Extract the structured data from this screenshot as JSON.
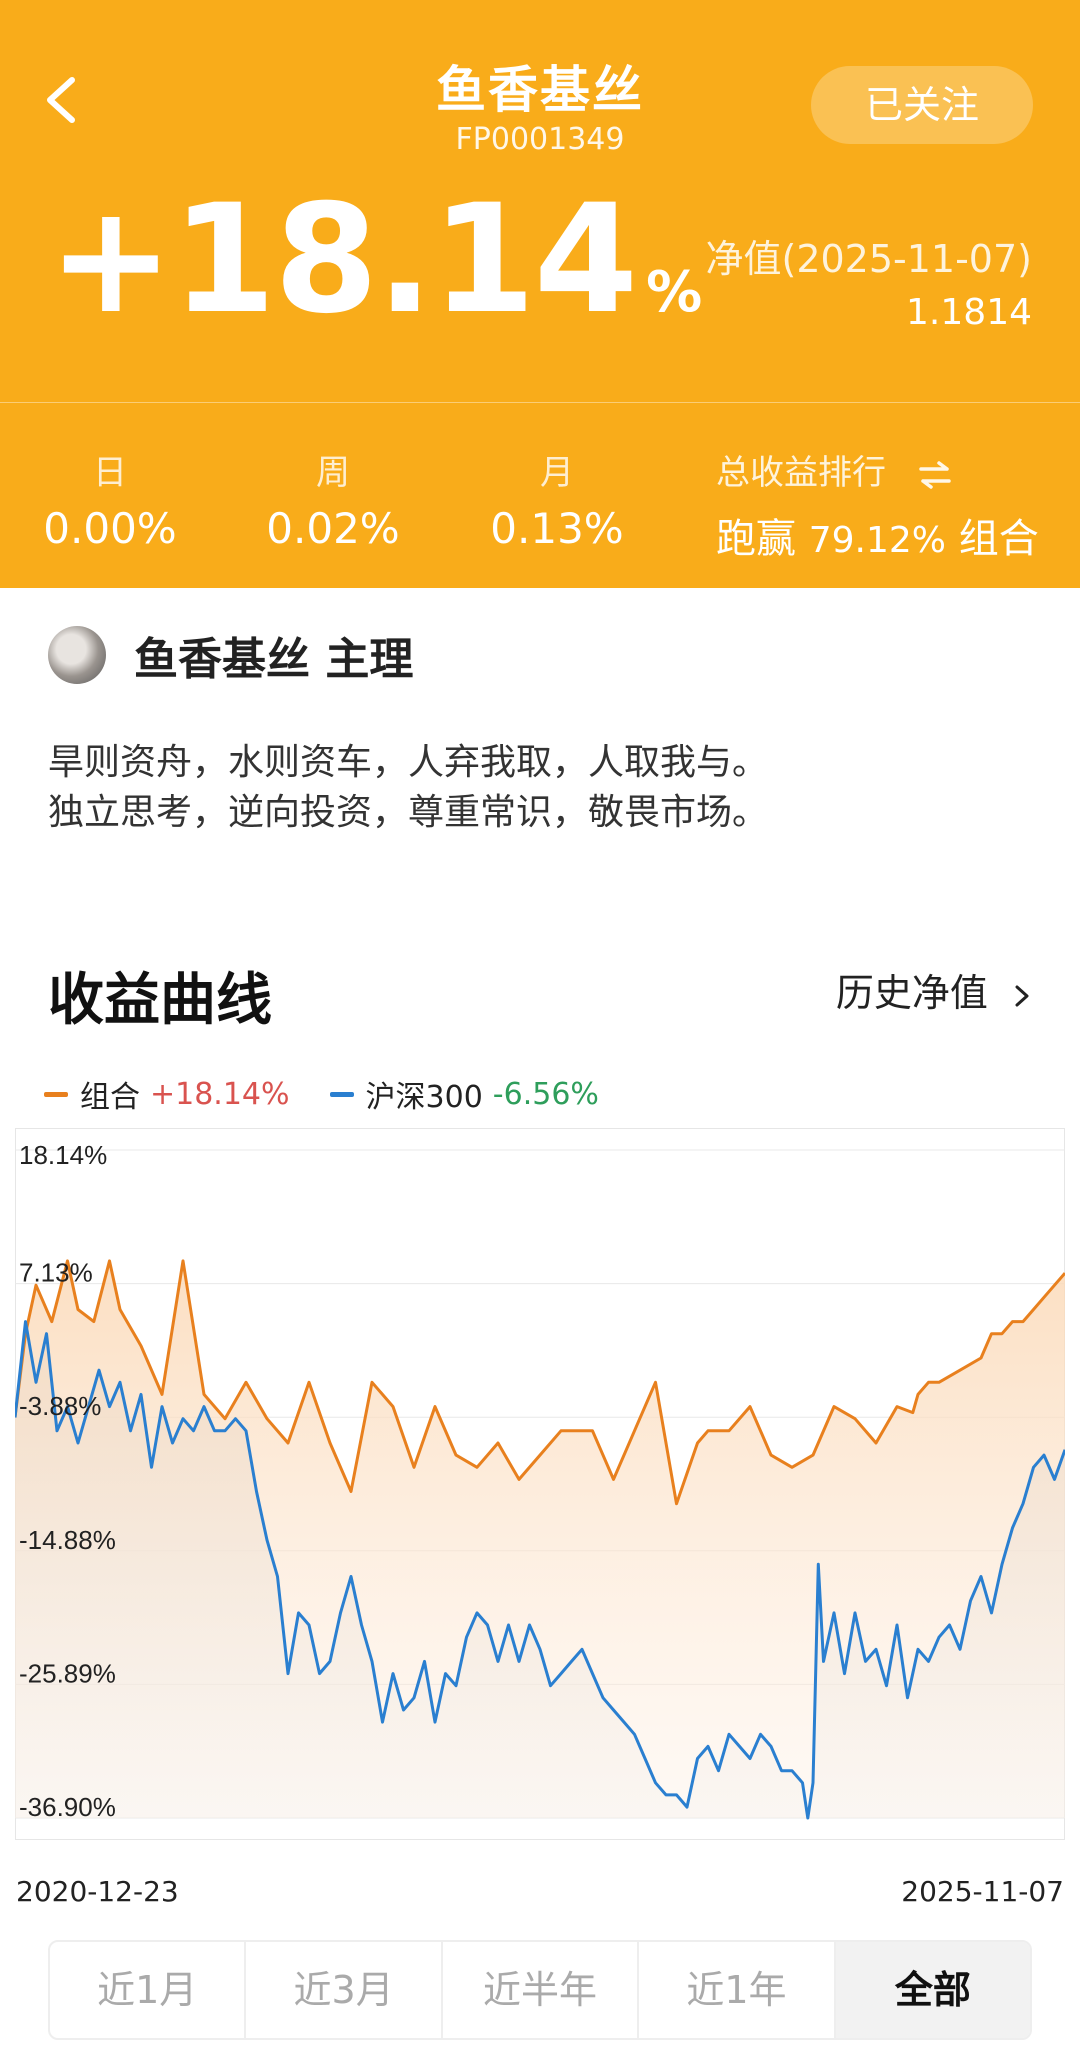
{
  "header": {
    "title": "鱼香基丝",
    "code": "FP0001349",
    "follow_label": "已关注",
    "total_return_value": "+18.14",
    "total_return_unit": "%",
    "nav_date_label": "净值(2025-11-07)",
    "nav_value": "1.1814",
    "bg_color": "#F9AC1A"
  },
  "stats": [
    {
      "label": "日",
      "value": "0.00%"
    },
    {
      "label": "周",
      "value": "0.02%"
    },
    {
      "label": "月",
      "value": "0.13%"
    }
  ],
  "rank": {
    "label": "总收益排行",
    "icon": "swap-icon",
    "prefix": "跑赢",
    "percent": "79.12%",
    "suffix": "组合"
  },
  "manager": {
    "name": "鱼香基丝",
    "role": "主理",
    "avatar": "cat-avatar",
    "description_line1": "旱则资舟，水则资车，人弃我取，人取我与。",
    "description_line2": "独立思考，逆向投资，尊重常识，敬畏市场。"
  },
  "section": {
    "title": "收益曲线",
    "history_label": "历史净值"
  },
  "legend": [
    {
      "name": "组合",
      "value": "+18.14%",
      "color": "#E8801E",
      "value_color": "#D9534F"
    },
    {
      "name": "沪深300",
      "value": "-6.56%",
      "color": "#2A7FD0",
      "value_color": "#2E9E5B"
    }
  ],
  "chart_data": {
    "type": "area",
    "x_start": "2020-12-23",
    "x_end": "2025-11-07",
    "y_ticks": [
      "18.14%",
      "7.13%",
      "-3.88%",
      "-14.88%",
      "-25.89%",
      "-36.90%"
    ],
    "ylim": [
      -36.9,
      18.14
    ],
    "grid": true,
    "series": [
      {
        "name": "组合",
        "color": "#E8801E",
        "points": [
          [
            0.0,
            -3.9
          ],
          [
            0.01,
            3
          ],
          [
            0.02,
            7
          ],
          [
            0.035,
            4
          ],
          [
            0.05,
            9
          ],
          [
            0.06,
            5
          ],
          [
            0.075,
            4
          ],
          [
            0.09,
            9
          ],
          [
            0.1,
            5
          ],
          [
            0.12,
            2
          ],
          [
            0.14,
            -2
          ],
          [
            0.16,
            9
          ],
          [
            0.18,
            -2
          ],
          [
            0.2,
            -4
          ],
          [
            0.22,
            -1
          ],
          [
            0.24,
            -4
          ],
          [
            0.26,
            -6
          ],
          [
            0.28,
            -1
          ],
          [
            0.3,
            -6
          ],
          [
            0.32,
            -10
          ],
          [
            0.34,
            -1
          ],
          [
            0.36,
            -3
          ],
          [
            0.38,
            -8
          ],
          [
            0.4,
            -3
          ],
          [
            0.42,
            -7
          ],
          [
            0.44,
            -8
          ],
          [
            0.46,
            -6
          ],
          [
            0.48,
            -9
          ],
          [
            0.5,
            -7
          ],
          [
            0.52,
            -5
          ],
          [
            0.55,
            -5
          ],
          [
            0.57,
            -9
          ],
          [
            0.59,
            -5
          ],
          [
            0.61,
            -1
          ],
          [
            0.63,
            -11
          ],
          [
            0.65,
            -6
          ],
          [
            0.66,
            -5
          ],
          [
            0.68,
            -5
          ],
          [
            0.7,
            -3
          ],
          [
            0.72,
            -7
          ],
          [
            0.74,
            -8
          ],
          [
            0.76,
            -7
          ],
          [
            0.78,
            -3
          ],
          [
            0.8,
            -4
          ],
          [
            0.82,
            -6
          ],
          [
            0.84,
            -3
          ],
          [
            0.855,
            -3.5
          ],
          [
            0.86,
            -2
          ],
          [
            0.87,
            -1
          ],
          [
            0.88,
            -1
          ],
          [
            0.9,
            0
          ],
          [
            0.92,
            1
          ],
          [
            0.93,
            3
          ],
          [
            0.94,
            3
          ],
          [
            0.95,
            4
          ],
          [
            0.96,
            4
          ],
          [
            0.97,
            5
          ],
          [
            0.98,
            6
          ],
          [
            0.99,
            7
          ],
          [
            1.0,
            8
          ]
        ]
      },
      {
        "name": "沪深300",
        "color": "#2A7FD0",
        "points": [
          [
            0.0,
            -3.9
          ],
          [
            0.01,
            4
          ],
          [
            0.02,
            -1
          ],
          [
            0.03,
            3
          ],
          [
            0.04,
            -5
          ],
          [
            0.05,
            -3
          ],
          [
            0.06,
            -6
          ],
          [
            0.07,
            -3
          ],
          [
            0.08,
            0
          ],
          [
            0.09,
            -3
          ],
          [
            0.1,
            -1
          ],
          [
            0.11,
            -5
          ],
          [
            0.12,
            -2
          ],
          [
            0.13,
            -8
          ],
          [
            0.14,
            -3
          ],
          [
            0.15,
            -6
          ],
          [
            0.16,
            -4
          ],
          [
            0.17,
            -5
          ],
          [
            0.18,
            -3
          ],
          [
            0.19,
            -5
          ],
          [
            0.2,
            -5
          ],
          [
            0.21,
            -4
          ],
          [
            0.22,
            -5
          ],
          [
            0.23,
            -10
          ],
          [
            0.24,
            -14
          ],
          [
            0.25,
            -17
          ],
          [
            0.26,
            -25
          ],
          [
            0.27,
            -20
          ],
          [
            0.28,
            -21
          ],
          [
            0.29,
            -25
          ],
          [
            0.3,
            -24
          ],
          [
            0.31,
            -20
          ],
          [
            0.32,
            -17
          ],
          [
            0.33,
            -21
          ],
          [
            0.34,
            -24
          ],
          [
            0.35,
            -29
          ],
          [
            0.36,
            -25
          ],
          [
            0.37,
            -28
          ],
          [
            0.38,
            -27
          ],
          [
            0.39,
            -24
          ],
          [
            0.4,
            -29
          ],
          [
            0.41,
            -25
          ],
          [
            0.42,
            -26
          ],
          [
            0.43,
            -22
          ],
          [
            0.44,
            -20
          ],
          [
            0.45,
            -21
          ],
          [
            0.46,
            -24
          ],
          [
            0.47,
            -21
          ],
          [
            0.48,
            -24
          ],
          [
            0.49,
            -21
          ],
          [
            0.5,
            -23
          ],
          [
            0.51,
            -26
          ],
          [
            0.52,
            -25
          ],
          [
            0.53,
            -24
          ],
          [
            0.54,
            -23
          ],
          [
            0.55,
            -25
          ],
          [
            0.56,
            -27
          ],
          [
            0.57,
            -28
          ],
          [
            0.58,
            -29
          ],
          [
            0.59,
            -30
          ],
          [
            0.6,
            -32
          ],
          [
            0.61,
            -34
          ],
          [
            0.62,
            -35
          ],
          [
            0.63,
            -35
          ],
          [
            0.64,
            -36
          ],
          [
            0.65,
            -32
          ],
          [
            0.66,
            -31
          ],
          [
            0.67,
            -33
          ],
          [
            0.68,
            -30
          ],
          [
            0.69,
            -31
          ],
          [
            0.7,
            -32
          ],
          [
            0.71,
            -30
          ],
          [
            0.72,
            -31
          ],
          [
            0.73,
            -33
          ],
          [
            0.74,
            -33
          ],
          [
            0.75,
            -34
          ],
          [
            0.755,
            -36.9
          ],
          [
            0.76,
            -34
          ],
          [
            0.765,
            -16
          ],
          [
            0.77,
            -24
          ],
          [
            0.78,
            -20
          ],
          [
            0.79,
            -25
          ],
          [
            0.8,
            -20
          ],
          [
            0.81,
            -24
          ],
          [
            0.82,
            -23
          ],
          [
            0.83,
            -26
          ],
          [
            0.84,
            -21
          ],
          [
            0.85,
            -27
          ],
          [
            0.86,
            -23
          ],
          [
            0.87,
            -24
          ],
          [
            0.88,
            -22
          ],
          [
            0.89,
            -21
          ],
          [
            0.9,
            -23
          ],
          [
            0.91,
            -19
          ],
          [
            0.92,
            -17
          ],
          [
            0.93,
            -20
          ],
          [
            0.94,
            -16
          ],
          [
            0.95,
            -13
          ],
          [
            0.96,
            -11
          ],
          [
            0.97,
            -8
          ],
          [
            0.98,
            -7
          ],
          [
            0.99,
            -9
          ],
          [
            1.0,
            -6.56
          ]
        ]
      }
    ]
  },
  "ranges": [
    {
      "label": "近1月",
      "active": false
    },
    {
      "label": "近3月",
      "active": false
    },
    {
      "label": "近半年",
      "active": false
    },
    {
      "label": "近1年",
      "active": false
    },
    {
      "label": "全部",
      "active": true
    }
  ]
}
